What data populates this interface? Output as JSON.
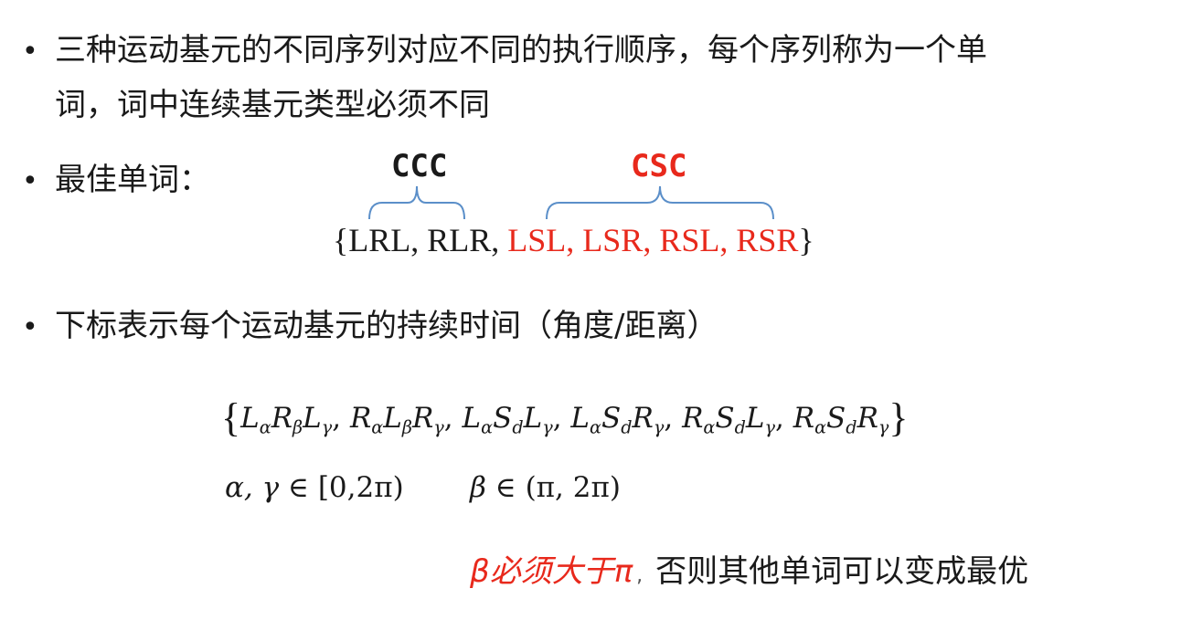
{
  "bullet1": {
    "line1": "三种运动基元的不同序列对应不同的执行顺序，每个序列称为一个单",
    "line2": "词，词中连续基元类型必须不同"
  },
  "bullet2": {
    "label": "最佳单词：",
    "ccc_label": "CCC",
    "csc_label": "CSC",
    "open_brace": "{",
    "ccc_words": "LRL, RLR,",
    "csc_words": "LSL, LSR, RSL, RSR",
    "close_brace": "}"
  },
  "bullet3": {
    "text": "下标表示每个运动基元的持续时间（角度/距离）"
  },
  "math": {
    "words_set": [
      {
        "a": "L",
        "as": "α",
        "b": "R",
        "bs": "β",
        "c": "L",
        "cs": "γ"
      },
      {
        "a": "R",
        "as": "α",
        "b": "L",
        "bs": "β",
        "c": "R",
        "cs": "γ"
      },
      {
        "a": "L",
        "as": "α",
        "b": "S",
        "bs": "d",
        "c": "L",
        "cs": "γ"
      },
      {
        "a": "L",
        "as": "α",
        "b": "S",
        "bs": "d",
        "c": "R",
        "cs": "γ"
      },
      {
        "a": "R",
        "as": "α",
        "b": "S",
        "bs": "d",
        "c": "L",
        "cs": "γ"
      },
      {
        "a": "R",
        "as": "α",
        "b": "S",
        "bs": "d",
        "c": "R",
        "cs": "γ"
      }
    ],
    "range1_vars": "α, γ",
    "range1_set": "∈ [0,2π)",
    "range2_var": "β",
    "range2_set": "∈ (π, 2π)"
  },
  "note": {
    "red_part": "β必须大于π",
    "sep": ",",
    "black_part": "否则其他单词可以变成最优"
  }
}
